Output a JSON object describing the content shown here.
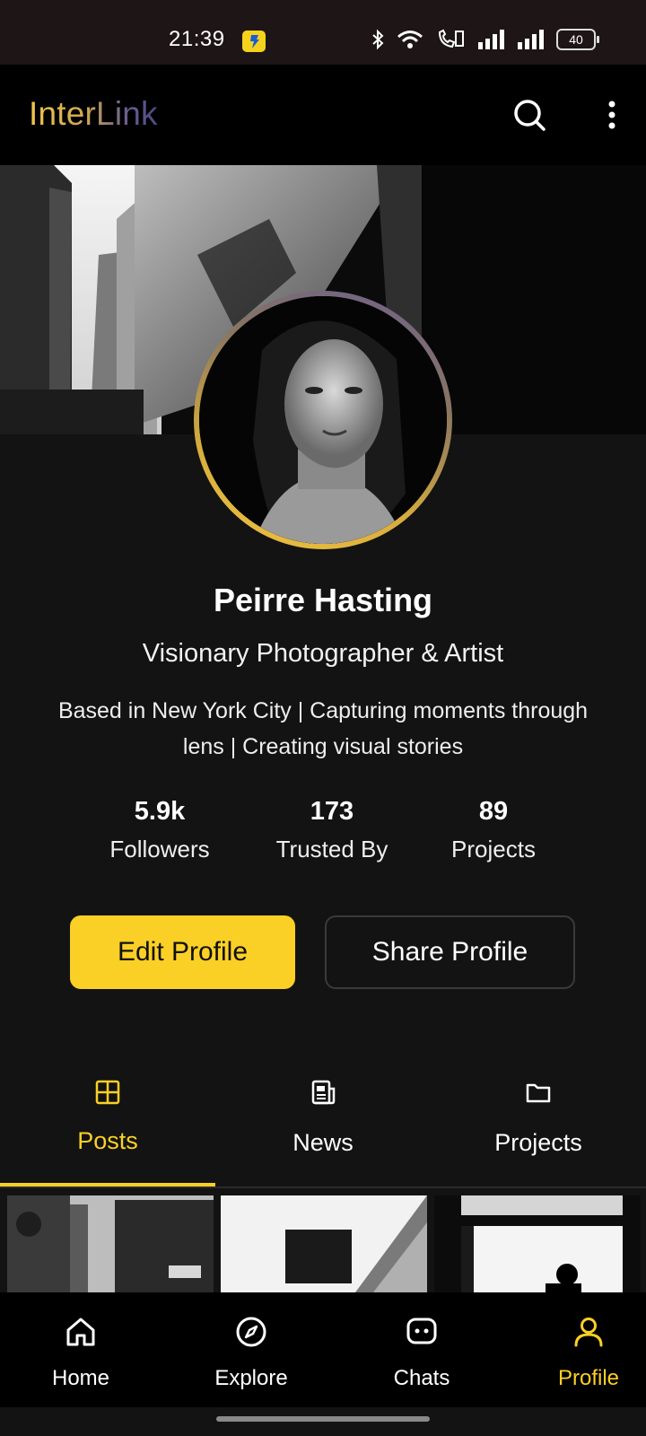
{
  "status_bar": {
    "time": "21:39",
    "battery": "40",
    "icons": [
      "bluetooth-icon",
      "wifi-icon",
      "call-icon",
      "signal-icon",
      "signal-icon",
      "battery-icon"
    ]
  },
  "app_bar": {
    "brand": "InterLink",
    "icons": [
      "search-icon",
      "more-vertical-icon"
    ]
  },
  "profile": {
    "name": "Peirre Hasting",
    "title": "Visionary Photographer & Artist",
    "bio": "Based in New York City | Capturing moments through lens | Creating visual stories"
  },
  "stats": [
    {
      "value": "5.9k",
      "label": "Followers"
    },
    {
      "value": "173",
      "label": "Trusted By"
    },
    {
      "value": "89",
      "label": "Projects"
    }
  ],
  "actions": {
    "edit_label": "Edit Profile",
    "share_label": "Share Profile"
  },
  "tabs": [
    {
      "label": "Posts",
      "icon": "grid-icon",
      "active": true
    },
    {
      "label": "News",
      "icon": "newspaper-icon",
      "active": false
    },
    {
      "label": "Projects",
      "icon": "folder-icon",
      "active": false
    }
  ],
  "bottom_nav": [
    {
      "label": "Home",
      "icon": "home-icon",
      "active": false
    },
    {
      "label": "Explore",
      "icon": "compass-icon",
      "active": false
    },
    {
      "label": "Chats",
      "icon": "chat-icon",
      "active": false
    },
    {
      "label": "Profile",
      "icon": "user-icon",
      "active": true
    }
  ],
  "colors": {
    "accent": "#fbd026",
    "background": "#131313",
    "app_bar": "#000000"
  }
}
